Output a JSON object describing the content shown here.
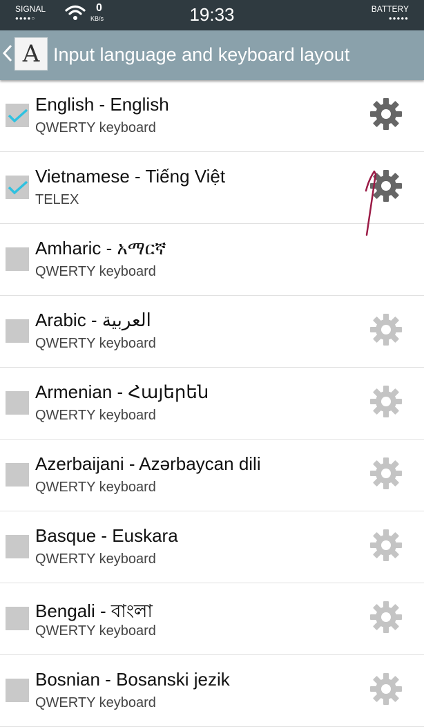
{
  "status_bar": {
    "signal_label": "SIGNAL",
    "signal_dots": "●●●●○",
    "speed_value": "0",
    "speed_unit": "KB/s",
    "time": "19:33",
    "battery_label": "BATTERY",
    "battery_dots": "●●●●●"
  },
  "header": {
    "title": "Input language and keyboard layout",
    "app_icon_glyph": "A"
  },
  "colors": {
    "header_bg": "#8aa1ab",
    "status_bg": "#2f3a40",
    "check_accent": "#2fc1e0",
    "checkbox_gray": "#c9c9c9",
    "gear_dark": "#666666",
    "gear_light": "#c4c4c4",
    "annotation": "#9b1b46"
  },
  "languages": [
    {
      "name": "English - English",
      "layout": "QWERTY keyboard",
      "checked": true,
      "gear": "gear-icon"
    },
    {
      "name": "Vietnamese - Tiếng Việt",
      "layout": "TELEX",
      "checked": true,
      "gear": "gear-icon"
    },
    {
      "name": "Amharic - አማርኛ",
      "layout": "QWERTY keyboard",
      "checked": false,
      "gear": ""
    },
    {
      "name": "Arabic - العربية",
      "layout": "QWERTY keyboard",
      "checked": false,
      "gear": "gear-icon"
    },
    {
      "name": "Armenian - Հայերեն",
      "layout": "QWERTY keyboard",
      "checked": false,
      "gear": "gear-icon"
    },
    {
      "name": "Azerbaijani - Azərbaycan dili",
      "layout": "QWERTY keyboard",
      "checked": false,
      "gear": "gear-icon"
    },
    {
      "name": "Basque - Euskara",
      "layout": "QWERTY keyboard",
      "checked": false,
      "gear": "gear-icon"
    },
    {
      "name": "Bengali - বাংলা",
      "layout": "QWERTY keyboard",
      "checked": false,
      "gear": "gear-icon"
    },
    {
      "name": "Bosnian - Bosanski jezik",
      "layout": "QWERTY keyboard",
      "checked": false,
      "gear": "gear-icon"
    }
  ]
}
